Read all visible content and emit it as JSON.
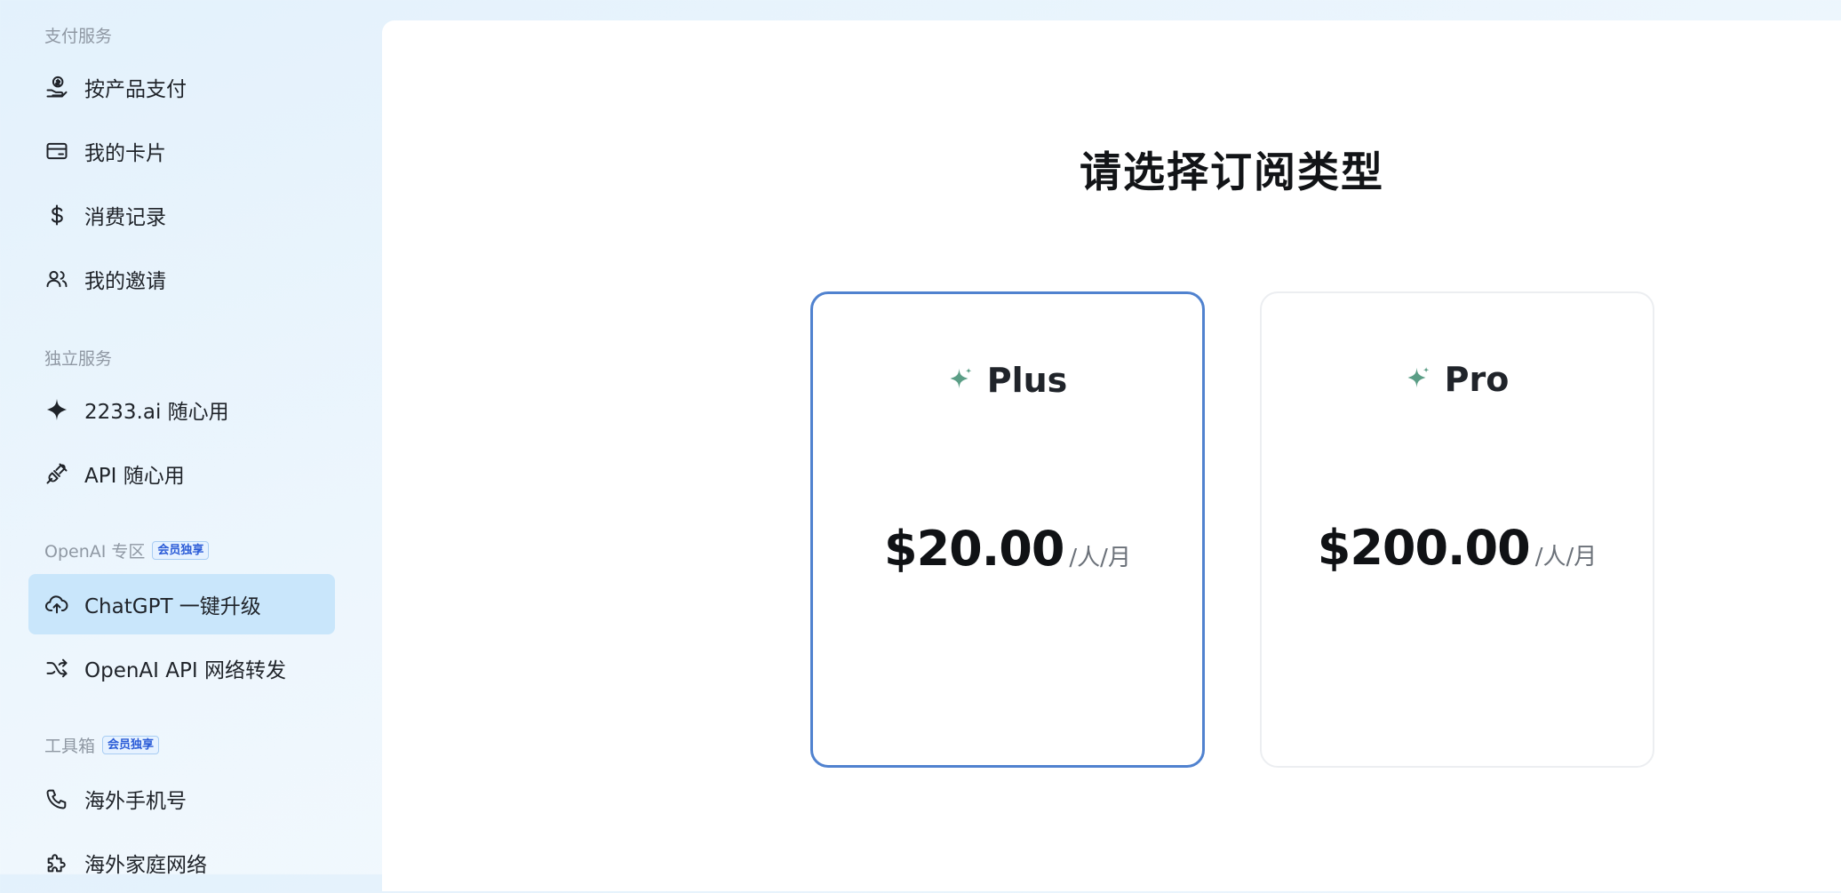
{
  "sidebar": {
    "sections": [
      {
        "label": "支付服务",
        "items": [
          {
            "label": "按产品支付",
            "icon": "hand-coin-icon"
          },
          {
            "label": "我的卡片",
            "icon": "card-icon"
          },
          {
            "label": "消费记录",
            "icon": "dollar-icon"
          },
          {
            "label": "我的邀请",
            "icon": "users-icon"
          }
        ]
      },
      {
        "label": "独立服务",
        "items": [
          {
            "label": "2233.ai 随心用",
            "icon": "sparkle-icon"
          },
          {
            "label": "API 随心用",
            "icon": "plug-icon"
          }
        ]
      },
      {
        "label": "OpenAI 专区",
        "badge": "会员独享",
        "items": [
          {
            "label": "ChatGPT 一键升级",
            "icon": "cloud-upload-icon",
            "active": true
          },
          {
            "label": "OpenAI API 网络转发",
            "icon": "shuffle-icon"
          }
        ]
      },
      {
        "label": "工具箱",
        "badge": "会员独享",
        "items": [
          {
            "label": "海外手机号",
            "icon": "phone-icon"
          },
          {
            "label": "海外家庭网络",
            "icon": "puzzle-icon"
          }
        ]
      }
    ]
  },
  "main": {
    "title": "请选择订阅类型",
    "plans": [
      {
        "name": "Plus",
        "price": "$20.00",
        "unit": "/人/月",
        "selected": true,
        "icon": "sparkle-icon"
      },
      {
        "name": "Pro",
        "price": "$200.00",
        "unit": "/人/月",
        "selected": false,
        "icon": "sparkle-icon"
      }
    ]
  },
  "colors": {
    "accent_border": "#5082cf",
    "active_nav_bg": "#c9e6fb",
    "sparkle": "#5b9e86",
    "badge_text": "#2a5bd7"
  }
}
